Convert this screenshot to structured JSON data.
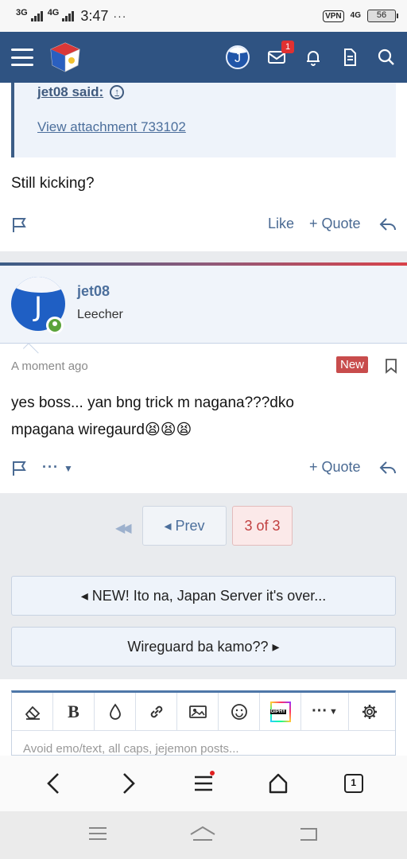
{
  "status_bar": {
    "network1": "3G",
    "network2": "4G",
    "time": "3:47",
    "dots": "···",
    "vpn": "VPN",
    "fourg": "4G",
    "battery": "56"
  },
  "header": {
    "notification_count": "1"
  },
  "quote": {
    "author": "jet08 said:",
    "attachment_link": "View attachment 733102"
  },
  "post1": {
    "text": "Still kicking?",
    "like": "Like",
    "quote": "+ Quote"
  },
  "post2": {
    "username": "jet08",
    "user_title": "Leecher",
    "avatar_letter": "J",
    "time": "A moment ago",
    "new_badge": "New",
    "text_line1": "yes boss... yan bng trick m nagana???dko",
    "text_line2": "mpagana wiregaurd😫😫😫",
    "more": "···",
    "quote": "+ Quote"
  },
  "pagination": {
    "prev": "◂ Prev",
    "current": "3 of 3"
  },
  "thread_nav": {
    "previous_thread": "◂ NEW! Ito na, Japan Server it's over...",
    "next_thread": "Wireguard ba kamo?? ▸"
  },
  "editor": {
    "bold": "B",
    "more": "···",
    "giphy": "GIPHY",
    "placeholder": "Avoid emo/text, all caps, jejemon posts..."
  },
  "browser": {
    "tabs_count": "1"
  },
  "colors": {
    "header_bg": "#2f5382",
    "accent_link": "#4c6f9c",
    "new_badge": "#c84c4c",
    "current_page": "#c14040"
  }
}
